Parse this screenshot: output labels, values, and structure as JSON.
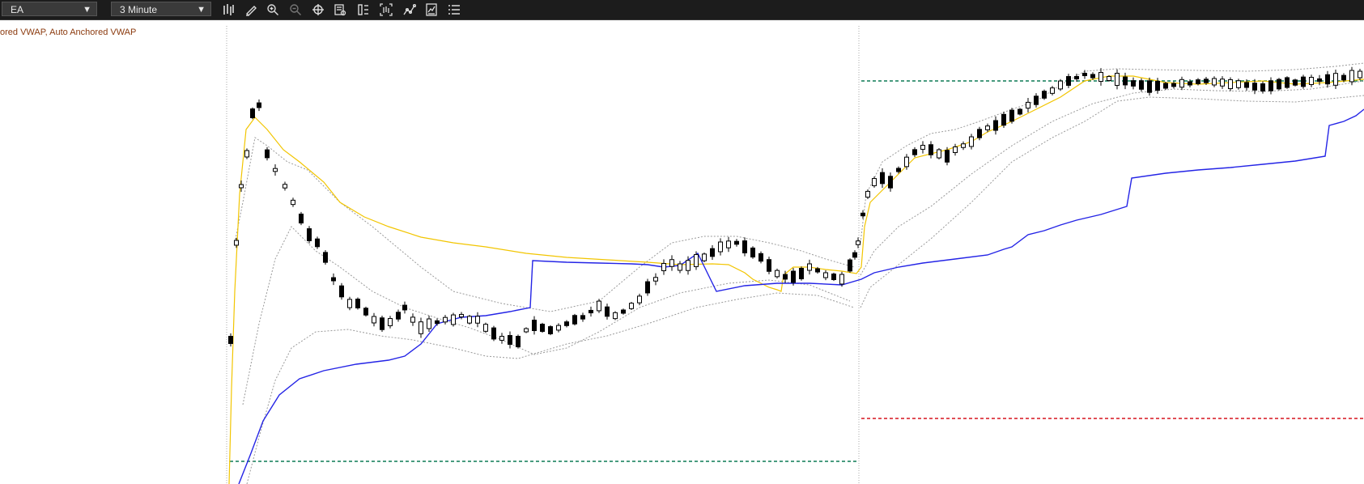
{
  "toolbar": {
    "symbol": "EA",
    "interval": "3 Minute",
    "tools": [
      {
        "name": "bar-type-icon"
      },
      {
        "name": "draw-pencil-icon"
      },
      {
        "name": "zoom-in-icon"
      },
      {
        "name": "zoom-out-icon"
      },
      {
        "name": "crosshair-icon"
      },
      {
        "name": "data-box-icon"
      },
      {
        "name": "properties-icon"
      },
      {
        "name": "chart-style-icon"
      },
      {
        "name": "indicators-icon"
      },
      {
        "name": "strategy-icon"
      },
      {
        "name": "object-list-icon"
      }
    ]
  },
  "study_label": "ored VWAP, Auto Anchored VWAP",
  "colors": {
    "toolbar_bg": "#1c1c1c",
    "vwap_yellow": "#f2c500",
    "vwap_blue": "#2424e6",
    "band_gray": "#9a9a9a",
    "level_green": "#0b7a55",
    "level_red": "#d6141e"
  }
}
